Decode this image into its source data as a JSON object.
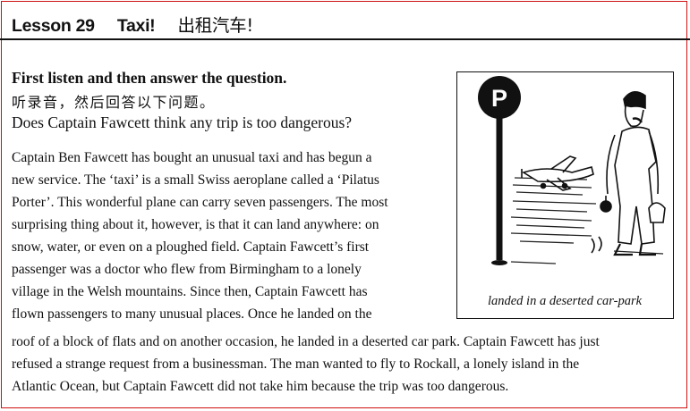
{
  "header": {
    "lesson": "Lesson 29",
    "title_en": "Taxi!",
    "title_zh": "出租汽车!"
  },
  "instructions": {
    "en": "First listen and then answer the question.",
    "zh": "听录音，然后回答以下问题。",
    "question": "Does Captain Fawcett think any trip is too dangerous?"
  },
  "passage_lines": [
    "Captain Ben Fawcett has bought an unusual taxi and has begun a",
    "new service. The ‘taxi’ is a small Swiss aeroplane called a ‘Pilatus",
    "Porter’. This wonderful  plane can carry seven passengers. The most",
    "surprising thing about it, however, is that it can land anywhere: on",
    "snow, water, or even on a ploughed field. Captain Fawcett’s first",
    "passenger was a doctor who flew from Birmingham to a lonely",
    "village in the Welsh mountains. Since then, Captain Fawcett has",
    "flown passengers to many unusual places. Once he landed on the",
    "roof of a block of flats and on another occasion, he landed in a deserted car park. Captain Fawcett has just",
    "refused a strange request from a businessman. The man wanted to fly to Rockall, a lonely island in the",
    "Atlantic Ocean, but Captain Fawcett did not take him because the trip was too dangerous."
  ],
  "illustration": {
    "sign_letter": "P",
    "caption": "landed in a deserted car-park"
  },
  "colors": {
    "border": "#d01010",
    "ink": "#111111"
  }
}
